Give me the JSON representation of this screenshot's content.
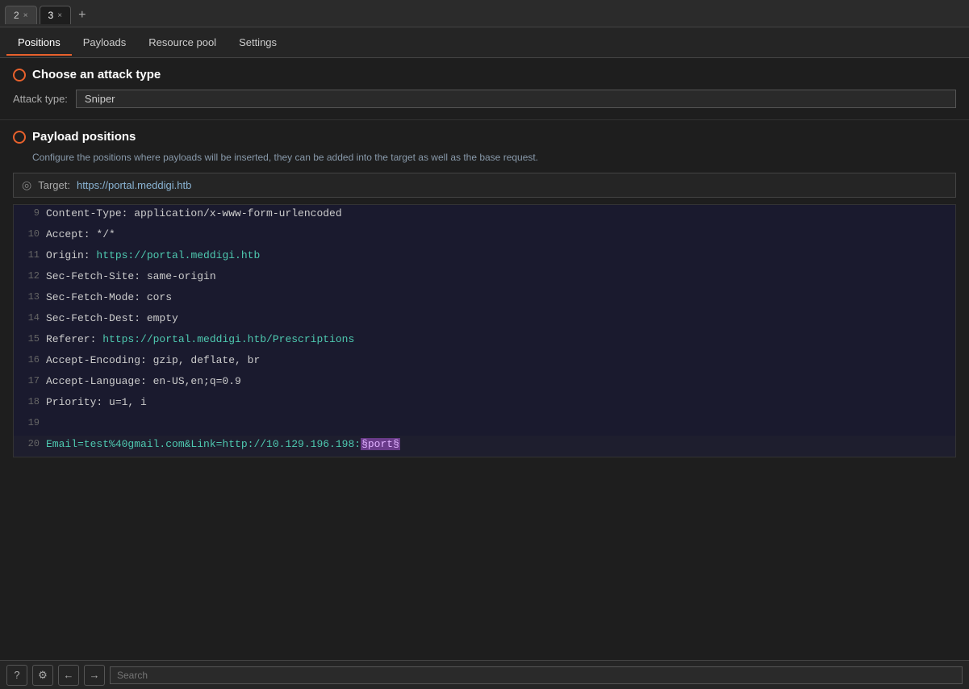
{
  "tabs": [
    {
      "id": "tab-2",
      "label": "2",
      "active": false
    },
    {
      "id": "tab-3",
      "label": "3",
      "active": true
    }
  ],
  "nav_tabs": [
    {
      "id": "positions",
      "label": "Positions",
      "active": true
    },
    {
      "id": "payloads",
      "label": "Payloads",
      "active": false
    },
    {
      "id": "resource_pool",
      "label": "Resource pool",
      "active": false
    },
    {
      "id": "settings",
      "label": "Settings",
      "active": false
    }
  ],
  "attack": {
    "section_title": "Choose an attack type",
    "attack_type_label": "Attack type:",
    "attack_type_value": "Sniper"
  },
  "payload_positions": {
    "section_title": "Payload positions",
    "description": "Configure the positions where payloads will be inserted, they can be added into the target as well as the base request.",
    "target_label": "Target:",
    "target_value": "https://portal.meddigi.htb"
  },
  "code_lines": [
    {
      "num": "9",
      "content": "Content-Type: application/x-www-form-urlencoded"
    },
    {
      "num": "10",
      "content": "Accept: */*"
    },
    {
      "num": "11",
      "content": "Origin: https://portal.meddigi.htb"
    },
    {
      "num": "12",
      "content": "Sec-Fetch-Site: same-origin"
    },
    {
      "num": "13",
      "content": "Sec-Fetch-Mode: cors"
    },
    {
      "num": "14",
      "content": "Sec-Fetch-Dest: empty"
    },
    {
      "num": "15",
      "content": "Referer: https://portal.meddigi.htb/Prescriptions"
    },
    {
      "num": "16",
      "content": "Accept-Encoding: gzip, deflate, br"
    },
    {
      "num": "17",
      "content": "Accept-Language: en-US,en;q=0.9"
    },
    {
      "num": "18",
      "content": "Priority: u=1, i"
    },
    {
      "num": "19",
      "content": ""
    },
    {
      "num": "20",
      "content_special": true,
      "before": "Email=test%40gmail.com&Link=http://10.129.196.198:",
      "highlighted": "§port§",
      "after": ""
    }
  ],
  "bottom": {
    "search_placeholder": "Search",
    "help_icon": "?",
    "settings_icon": "⚙",
    "back_icon": "←",
    "forward_icon": "→"
  }
}
